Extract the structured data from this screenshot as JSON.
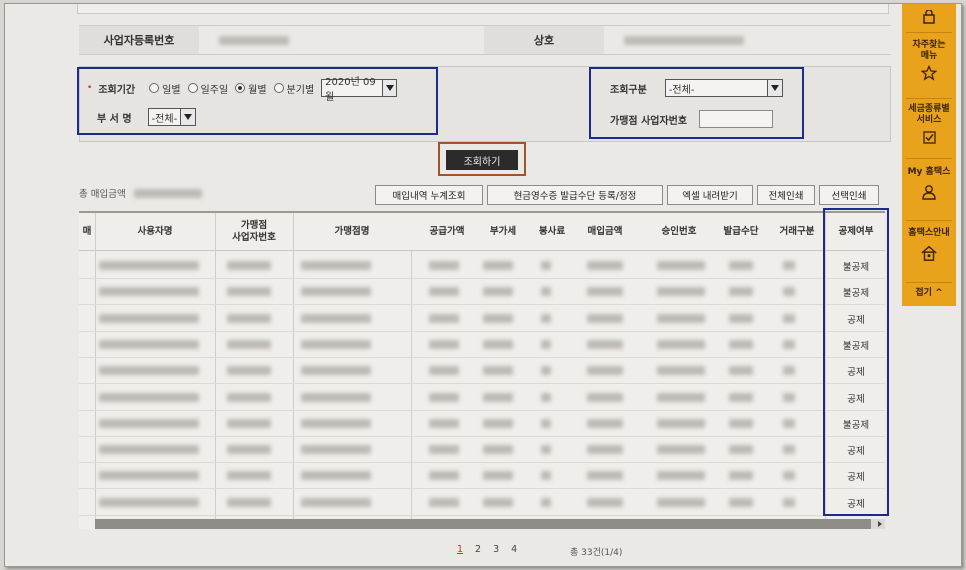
{
  "info": {
    "biz_reg_no_label": "사업자등록번호",
    "company_label": "상호"
  },
  "search": {
    "period_label": "조회기간",
    "period_options": [
      "일별",
      "일주일",
      "월별",
      "분기별"
    ],
    "period_selected": "월별",
    "month_value": "2020년 09월",
    "dept_label": "부 서 명",
    "dept_value": "-전체-",
    "type_label": "조회구분",
    "type_value": "-전체-",
    "merchant_bizno_label": "가맹점 사업자번호",
    "merchant_bizno_value": "",
    "search_button": "조회하기"
  },
  "toolbar": {
    "total_label": "총 매입금액",
    "buttons": [
      "매입내역 누계조회",
      "현금영수증 발급수단 등록/정정",
      "엑셀 내려받기",
      "전체인쇄",
      "선택인쇄"
    ]
  },
  "table": {
    "columns": [
      "매",
      "사용자명",
      "가맹점\n사업자번호",
      "가맹점명",
      "공급가액",
      "부가세",
      "봉사료",
      "매입금액",
      "승인번호",
      "발급수단",
      "거래구분",
      "공제여부"
    ],
    "deduction": [
      "불공제",
      "불공제",
      "공제",
      "불공제",
      "공제",
      "공제",
      "불공제",
      "공제",
      "공제",
      "공제"
    ]
  },
  "pagination": {
    "pages": [
      "1",
      "2",
      "3",
      "4"
    ],
    "current": "1",
    "summary": "총 33건(1/4)"
  },
  "sidebar": {
    "items": [
      "자주찾는 메뉴",
      "세금종류별 서비스",
      "My 홈택스",
      "홈택스안내",
      "접기 ^"
    ]
  }
}
